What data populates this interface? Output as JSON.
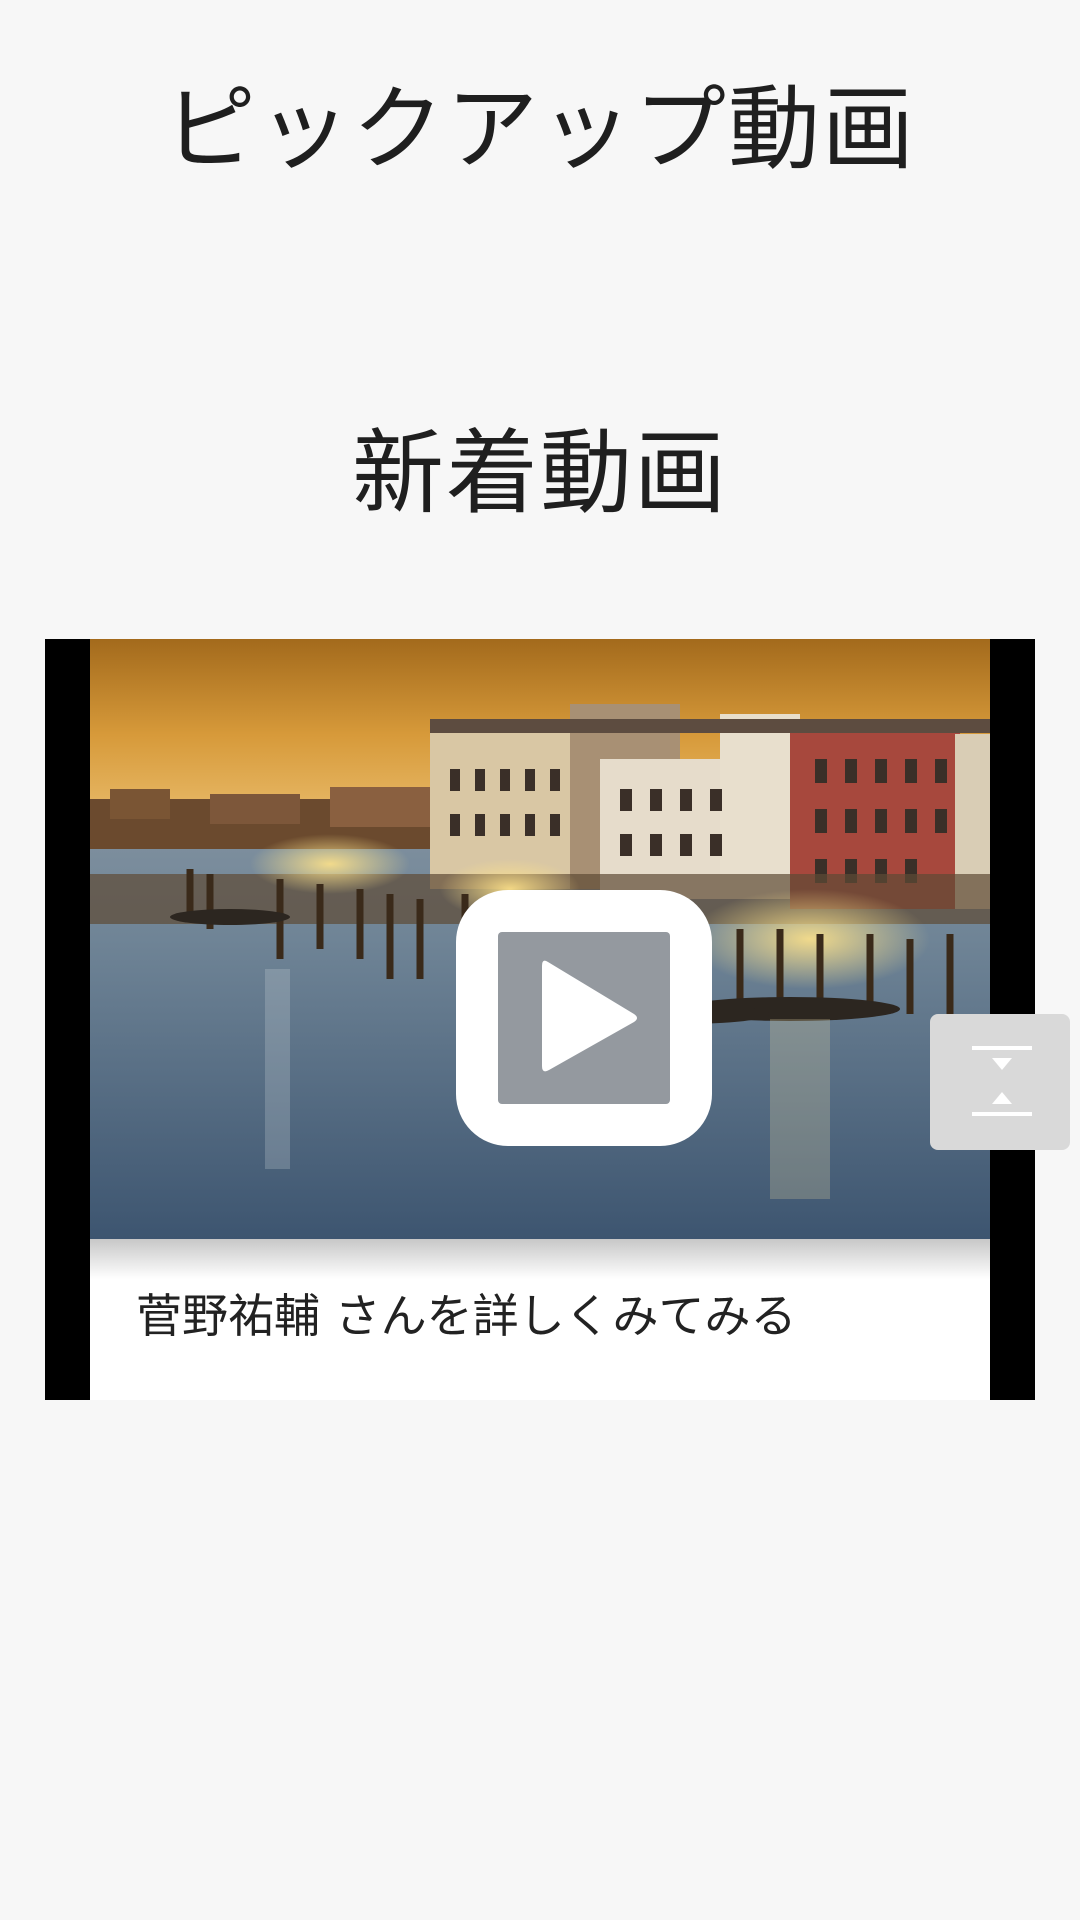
{
  "sections": {
    "pickup_title": "ピックアップ動画",
    "new_title": "新着動画"
  },
  "video_card": {
    "caption": "菅野祐輔 さんを詳しくみてみる",
    "thumbnail_icon": "play-icon"
  },
  "scroll_tab": {
    "icon": "scroll-top-bottom-icon"
  },
  "colors": {
    "background": "#f7f7f7",
    "card_frame": "#000000",
    "scroll_tab": "#d9d9d9"
  }
}
